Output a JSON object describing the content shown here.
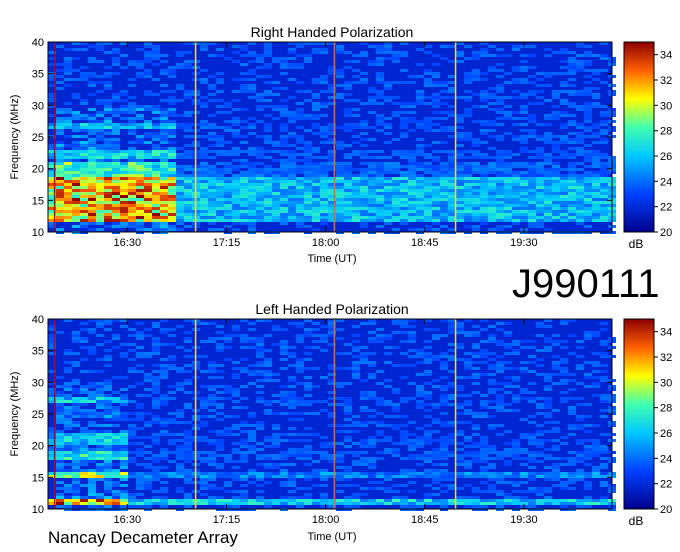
{
  "event_id": "J990111",
  "instrument": "Nancay Decameter Array",
  "chart_data": [
    {
      "type": "heatmap",
      "title": "Right Handed Polarization",
      "xlabel": "Time (UT)",
      "ylabel": "Frequency (MHz)",
      "x_tick_labels": [
        "16:30",
        "17:15",
        "18:00",
        "18:45",
        "19:30"
      ],
      "x_tick_minutes": [
        990,
        1035,
        1080,
        1125,
        1170
      ],
      "xlim_minutes": [
        954,
        1210
      ],
      "y_ticks": [
        10,
        15,
        20,
        25,
        30,
        35,
        40
      ],
      "ylim": [
        10,
        40
      ],
      "colorbar": {
        "label": "dB",
        "ticks": [
          20,
          22,
          24,
          26,
          28,
          30,
          32,
          34
        ],
        "range": [
          20,
          35
        ]
      },
      "strong_bands_MHz": [
        [
          12,
          19,
          33
        ],
        [
          19,
          21.5,
          28
        ],
        [
          22,
          23,
          27
        ],
        [
          26.5,
          27.5,
          26
        ]
      ],
      "intense_period_minutes": [
        956,
        1010
      ],
      "vertical_lines_minutes": [
        957,
        1021,
        1084,
        1139
      ]
    },
    {
      "type": "heatmap",
      "title": "Left Handed Polarization",
      "xlabel": "Time (UT)",
      "ylabel": "Frequency (MHz)",
      "x_tick_labels": [
        "16:30",
        "17:15",
        "18:00",
        "18:45",
        "19:30"
      ],
      "x_tick_minutes": [
        990,
        1035,
        1080,
        1125,
        1170
      ],
      "xlim_minutes": [
        954,
        1210
      ],
      "y_ticks": [
        10,
        15,
        20,
        25,
        30,
        35,
        40
      ],
      "ylim": [
        10,
        40
      ],
      "colorbar": {
        "label": "dB",
        "ticks": [
          20,
          22,
          24,
          26,
          28,
          30,
          32,
          34
        ],
        "range": [
          20,
          35
        ]
      },
      "strong_bands_MHz": [
        [
          11,
          11.8,
          34
        ],
        [
          15,
          16,
          30
        ],
        [
          18,
          19.5,
          27
        ],
        [
          20.5,
          22,
          26
        ],
        [
          27,
          28,
          26
        ]
      ],
      "intense_period_minutes": [
        956,
        990
      ],
      "vertical_lines_minutes": [
        957,
        1021,
        1084,
        1139
      ]
    }
  ]
}
